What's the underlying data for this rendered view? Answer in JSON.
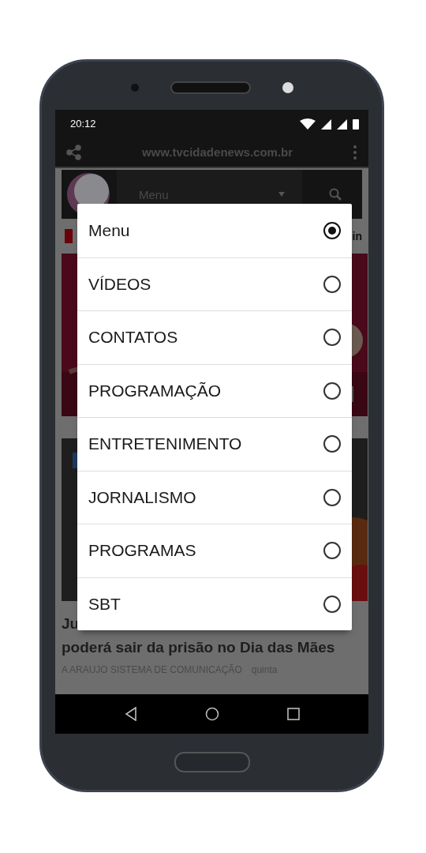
{
  "status_bar": {
    "time": "20:12"
  },
  "browser": {
    "url": "www.tvcidadenews.com.br"
  },
  "site_header": {
    "select": "Menu"
  },
  "social_band": {
    "text": "in"
  },
  "article": {
    "headline_start": "Ju",
    "headline": "poderá sair da prisão no Dia das Mães",
    "author": "A ARAUJO SISTEMA DE COMUNICAÇÃO",
    "date": "quinta"
  },
  "dialog": {
    "options": [
      {
        "label": "Menu",
        "selected": true
      },
      {
        "label": "VÍDEOS",
        "selected": false
      },
      {
        "label": "CONTATOS",
        "selected": false
      },
      {
        "label": "PROGRAMAÇÃO",
        "selected": false
      },
      {
        "label": "ENTRETENIMENTO",
        "selected": false
      },
      {
        "label": "JORNALISMO",
        "selected": false
      },
      {
        "label": "PROGRAMAS",
        "selected": false
      },
      {
        "label": "SBT",
        "selected": false
      }
    ]
  }
}
